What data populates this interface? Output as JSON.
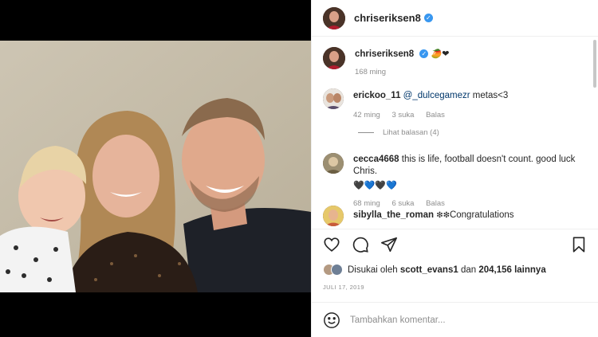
{
  "post": {
    "author": "chriseriksen8",
    "caption_emojis": "🥭❤",
    "caption_time": "168 ming"
  },
  "comments": [
    {
      "user": "erickoo_11",
      "mention": "@_dulcegamezr",
      "text": "metas<3",
      "time": "42 ming",
      "likes": "3 suka",
      "reply": "Balas"
    },
    {
      "user": "cecca4668",
      "text": "this is life, football doesn't count. good luck Chris.",
      "hearts": "🖤💙🖤💙",
      "time": "68 ming",
      "likes": "6 suka",
      "reply": "Balas"
    },
    {
      "user": "sibylla_the_roman",
      "text": "Congratulations",
      "emojis": "❇❇"
    }
  ],
  "view_replies": "Lihat balasan (4)",
  "likes": {
    "prefix": "Disukai oleh",
    "user": "scott_evans1",
    "middle": "dan",
    "count": "204,156 lainnya"
  },
  "date": "JULI 17, 2019",
  "add_comment": {
    "placeholder": "Tambahkan komentar..."
  },
  "icons": {
    "like": "heart-icon",
    "comment": "comment-icon",
    "share": "share-icon",
    "save": "bookmark-icon",
    "emoji": "emoji-icon"
  },
  "colors": {
    "verified": "#3897f0",
    "mention": "#00376b",
    "muted": "#8e8e8e"
  }
}
